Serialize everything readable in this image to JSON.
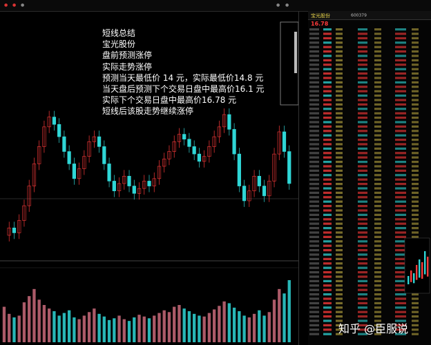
{
  "summary": {
    "lines": [
      "短线总结",
      "宝光股份",
      "盘前预测涨停",
      "实际走势涨停",
      "预测当天最低价 14 元，实际最低价14.8  元",
      "当天盘后预测下个交易日盘中最高价16.1    元",
      "实际下个交易日盘中最高价16.78 元",
      "短线后该股走势继续涨停"
    ]
  },
  "quote": {
    "stock_name": "宝光股份",
    "stock_code": "600379",
    "price": "16.78"
  },
  "watermark": "知乎 @臣服说",
  "colors": {
    "up": "#ff3b3b",
    "down": "#2fd6d6",
    "title": "#e8d44a",
    "volume": "#c96a7a"
  },
  "chart_data": {
    "type": "line",
    "values": [
      9.2,
      9.5,
      9.3,
      9.8,
      10.4,
      11.2,
      12.1,
      12.8,
      13.6,
      14.0,
      13.7,
      13.2,
      12.6,
      12.1,
      11.5,
      11.9,
      12.4,
      13.0,
      13.2,
      12.8,
      12.1,
      11.4,
      11.0,
      11.3,
      11.6,
      11.2,
      10.9,
      11.1,
      11.4,
      11.2,
      11.5,
      12.0,
      12.3,
      12.6,
      13.0,
      13.3,
      13.1,
      12.8,
      12.5,
      12.2,
      12.4,
      12.8,
      13.2,
      13.6,
      14.1,
      13.5,
      12.5,
      11.2,
      10.6,
      11.0,
      11.6,
      11.2,
      10.8,
      11.4,
      12.5,
      13.4,
      12.6,
      11.3
    ],
    "volume": [
      40,
      32,
      28,
      30,
      45,
      52,
      60,
      48,
      42,
      38,
      35,
      30,
      33,
      36,
      28,
      26,
      30,
      34,
      38,
      32,
      29,
      25,
      27,
      30,
      26,
      24,
      28,
      31,
      29,
      27,
      30,
      33,
      36,
      34,
      40,
      42,
      38,
      35,
      32,
      30,
      29,
      33,
      37,
      41,
      46,
      44,
      39,
      35,
      30,
      28,
      32,
      36,
      30,
      34,
      48,
      60,
      55,
      70
    ]
  }
}
